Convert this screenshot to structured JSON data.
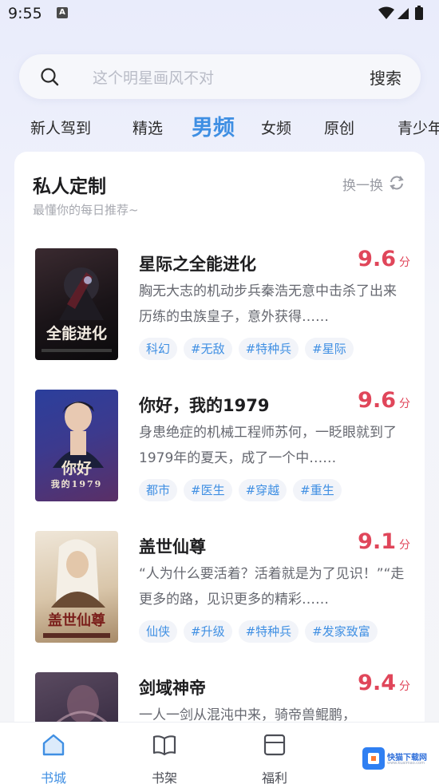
{
  "status_bar": {
    "time": "9:55",
    "notification_letter": "A"
  },
  "search": {
    "placeholder": "这个明星画风不对",
    "button_label": "搜索"
  },
  "tabs": [
    {
      "label": "新人驾到"
    },
    {
      "label": "精选"
    },
    {
      "label": "男频",
      "active": true
    },
    {
      "label": "女频"
    },
    {
      "label": "原创"
    },
    {
      "label": "青少年"
    }
  ],
  "section": {
    "title": "私人定制",
    "subtitle": "最懂你的每日推荐~",
    "refresh_label": "换一换"
  },
  "books": [
    {
      "title": "星际之全能进化",
      "score": "9.6",
      "score_unit": "分",
      "desc": "胸无大志的机动步兵秦浩无意中击杀了出来历练的虫族皇子，意外获得……",
      "tags": [
        "科幻",
        "#无敌",
        "#特种兵",
        "#星际"
      ],
      "cover_text": "全能进化",
      "cover_colors": [
        "#2a1e22",
        "#0d0b0e"
      ]
    },
    {
      "title": "你好，我的1979",
      "score": "9.6",
      "score_unit": "分",
      "desc": "身患绝症的机械工程师苏何，一眨眼就到了1979年的夏天，成了一个中……",
      "tags": [
        "都市",
        "#医生",
        "#穿越",
        "#重生"
      ],
      "cover_text": "你好",
      "cover_subtext": "我的1979",
      "cover_colors": [
        "#2d3a8c",
        "#4a2f6e"
      ]
    },
    {
      "title": "盖世仙尊",
      "score": "9.1",
      "score_unit": "分",
      "desc": "“人为什么要活着？活着就是为了见识！”“走更多的路，见识更多的精彩……",
      "tags": [
        "仙侠",
        "#升级",
        "#特种兵",
        "#发家致富"
      ],
      "cover_text": "盖世仙尊",
      "cover_colors": [
        "#e9ddc8",
        "#b8a184"
      ]
    },
    {
      "title": "剑域神帝",
      "score": "9.4",
      "score_unit": "分",
      "desc": "一人一剑从混沌中来，骑帝兽鲲鹏，",
      "tags": [],
      "cover_text": "",
      "cover_colors": [
        "#4a3a4e",
        "#2a2234"
      ]
    }
  ],
  "bottom_nav": [
    {
      "label": "书城",
      "icon": "bookstore-icon",
      "active": true
    },
    {
      "label": "书架",
      "icon": "bookshelf-icon"
    },
    {
      "label": "福利",
      "icon": "welfare-icon"
    }
  ],
  "watermark": {
    "text": "快猫下载网",
    "sub": "www.kuaimao.com"
  },
  "colors": {
    "accent": "#3f8fe3",
    "score": "#e0465a"
  }
}
